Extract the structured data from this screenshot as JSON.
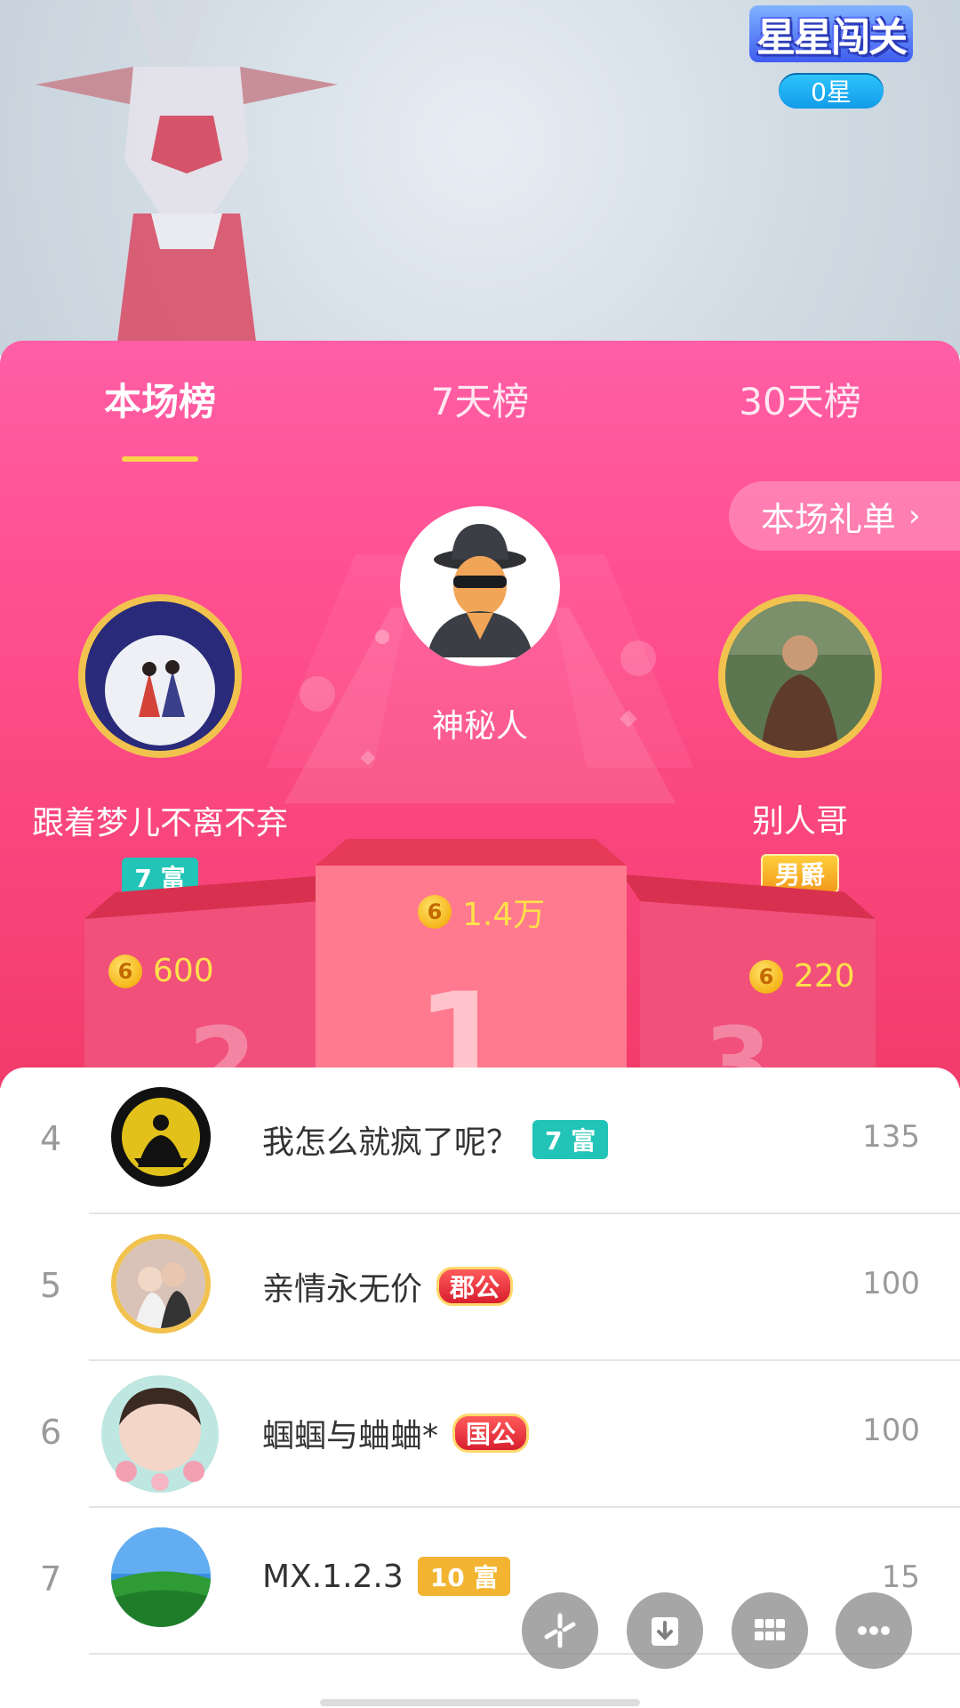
{
  "top_overlay": {
    "game_title": "星星闯关",
    "game_stars": "0星"
  },
  "tabs": [
    {
      "label": "本场榜",
      "active": true
    },
    {
      "label": "7天榜",
      "active": false
    },
    {
      "label": "30天榜",
      "active": false
    }
  ],
  "gift_list_button": "本场礼单",
  "podium": {
    "first": {
      "name": "神秘人",
      "score": "1.4万"
    },
    "second": {
      "name": "跟着梦儿不离不弃",
      "badge": "7 富",
      "score": "600"
    },
    "third": {
      "name": "别人哥",
      "badge": "男爵",
      "score": "220"
    }
  },
  "ranking_list": [
    {
      "rank": "4",
      "name": "我怎么就疯了呢？",
      "badge": "7 富",
      "badge_style": "teal",
      "value": "135"
    },
    {
      "rank": "5",
      "name": "亲情永无价",
      "badge": "郡公",
      "badge_style": "red",
      "value": "100"
    },
    {
      "rank": "6",
      "name": "蝈蝈与蛐蛐*",
      "badge": "国公",
      "badge_style": "red",
      "value": "100"
    },
    {
      "rank": "7",
      "name": "MX.1.2.3",
      "badge": "10 富",
      "badge_style": "orange",
      "value": "15"
    }
  ],
  "colors": {
    "panel_top": "#ff5ea6",
    "panel_bottom": "#f23b6a",
    "coin_text": "#ffe04a",
    "teal_badge": "#21c4b6",
    "tab_underline": "#ffd24a"
  },
  "toolbar_icons": [
    "sparkle-icon",
    "download-icon",
    "grid-icon",
    "more-icon"
  ]
}
